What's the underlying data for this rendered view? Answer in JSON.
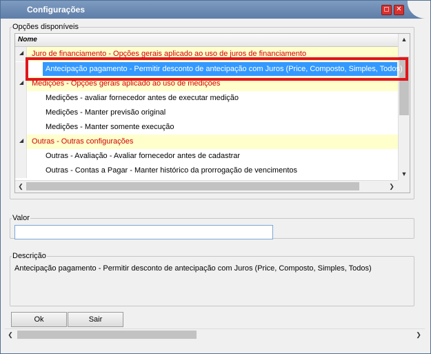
{
  "window": {
    "title": "Configurações",
    "restore_label": "◻",
    "close_label": "✕"
  },
  "opcoes": {
    "legend": "Opções disponíveis",
    "column_header": "Nome",
    "rows": [
      {
        "type": "group",
        "label": "Juro de financiamento - Opções gerais aplicado ao uso de juros de financiamento"
      },
      {
        "type": "item",
        "label": "Antecipação pagamento - Permitir desconto de antecipação com Juros (Price, Composto, Simples, Todos)",
        "selected": true
      },
      {
        "type": "group",
        "label": "Medições - Opções gerais aplicado ao uso de medições"
      },
      {
        "type": "item",
        "label": "Medições - avaliar fornecedor antes de executar medição"
      },
      {
        "type": "item",
        "label": "Medições - Manter previsão original"
      },
      {
        "type": "item",
        "label": "Medições - Manter somente execução"
      },
      {
        "type": "group",
        "label": "Outras - Outras configurações"
      },
      {
        "type": "item",
        "label": "Outras - Avaliação - Avaliar fornecedor antes de cadastrar"
      },
      {
        "type": "item",
        "label": "Outras - Contas a Pagar - Manter histórico da prorrogação de vencimentos"
      }
    ],
    "arrows": {
      "up": "▲",
      "down": "▼",
      "left": "❮",
      "right": "❯"
    }
  },
  "valor": {
    "legend": "Valor",
    "value": ""
  },
  "descricao": {
    "legend": "Descrição",
    "text": "Antecipação pagamento - Permitir desconto de antecipação com Juros (Price, Composto, Simples, Todos)"
  },
  "buttons": {
    "ok": "Ok",
    "sair": "Sair"
  },
  "colors": {
    "group_text": "#d00000",
    "group_bg": "#ffffcc",
    "selection": "#3399ff",
    "highlight_box": "#e0161b"
  }
}
